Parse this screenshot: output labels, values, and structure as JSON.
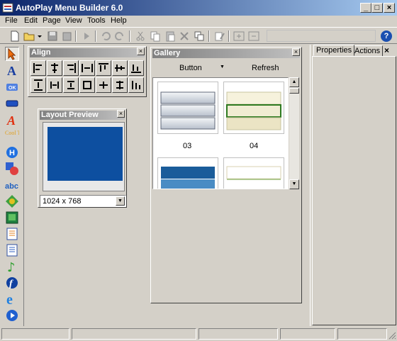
{
  "window": {
    "title": "AutoPlay Menu Builder 6.0",
    "btn_min": "_",
    "btn_max": "□",
    "btn_close": "×"
  },
  "menu": [
    "File",
    "Edit",
    "Page",
    "View",
    "Tools",
    "Help"
  ],
  "toolbar": {
    "help_label": "?"
  },
  "left_tools": [
    {
      "icon": "pointer-arrow-icon"
    },
    {
      "icon": "text-icon",
      "glyph": "A"
    },
    {
      "icon": "ok-button-icon",
      "glyph": "OK"
    },
    {
      "icon": "blue-bar-icon"
    },
    {
      "icon": "styled-text-icon",
      "glyph": "A"
    },
    {
      "icon": "cool-text-icon",
      "glyph": "Cool Text"
    },
    {
      "icon": "hotspot-icon",
      "glyph": "H"
    },
    {
      "icon": "shapes-icon"
    },
    {
      "icon": "abc-text-icon",
      "glyph": "abc"
    },
    {
      "icon": "globe-icon"
    },
    {
      "icon": "image-icon"
    },
    {
      "icon": "document-icon"
    },
    {
      "icon": "list-icon"
    },
    {
      "icon": "music-note-icon",
      "glyph": "♪"
    },
    {
      "icon": "flash-icon",
      "glyph": "f"
    },
    {
      "icon": "ie-icon",
      "glyph": "e"
    },
    {
      "icon": "media-player-icon",
      "glyph": "▶"
    }
  ],
  "align_panel": {
    "title": "Align",
    "close": "×"
  },
  "preview_panel": {
    "title": "Layout Preview",
    "close": "×",
    "resolution": "1024 x 768",
    "accent": "#0d4fa0"
  },
  "gallery_panel": {
    "title": "Gallery",
    "close": "×",
    "button_dropdown": "Button",
    "dropdown_arrow": "▼",
    "refresh": "Refresh",
    "items": [
      {
        "label": "03",
        "style": "gray-bars"
      },
      {
        "label": "04",
        "style": "cream-green"
      },
      {
        "label": "",
        "style": "blue-bars"
      },
      {
        "label": "",
        "style": "white-lines"
      }
    ]
  },
  "right_panel": {
    "tabs": [
      "Properties",
      "Actions"
    ],
    "close": "×"
  }
}
